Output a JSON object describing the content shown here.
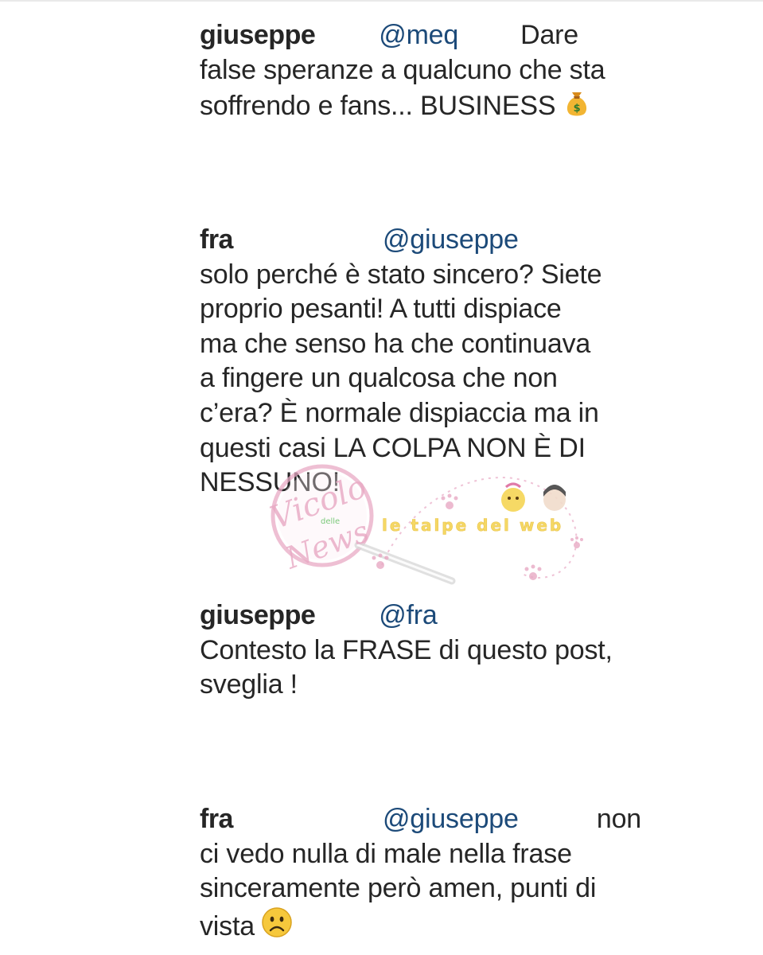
{
  "comments": [
    {
      "username": "giuseppe",
      "mention": "@meq",
      "lead_word": "Dare",
      "lines": [
        "false speranze a qualcuno che sta",
        "soffrendo e fans... BUSINESS"
      ],
      "trailing_emoji": "money-bag-icon"
    },
    {
      "username": "fra",
      "mention": "@giuseppe",
      "lead_word": "",
      "lines": [
        "solo perché è stato sincero? Siete",
        "proprio pesanti! A tutti dispiace",
        "ma che senso ha che continuava",
        "a fingere un qualcosa che non",
        "c’era? È normale dispiaccia ma in",
        "questi casi LA COLPA NON È DI",
        "NESSUNO!"
      ]
    },
    {
      "username": "giuseppe",
      "mention": "@fra",
      "lead_word": "",
      "lines": [
        "Contesto la FRASE di questo post,",
        "sveglia !"
      ]
    },
    {
      "username": "fra",
      "mention": "@giuseppe",
      "lead_word": "non",
      "lines": [
        "ci vedo nulla di male nella frase",
        "sinceramente però amen, punti di",
        "vista"
      ],
      "trailing_emoji": "frowning-face-icon"
    }
  ],
  "watermark": {
    "left_logo_script": "Vicolo",
    "left_logo_small": "delle",
    "left_logo_script2": "News",
    "right_logo_text": "le talpe del web"
  },
  "colors": {
    "text": "#262626",
    "mention": "#1c4a79",
    "watermark_pink": "#e8a9c4",
    "watermark_yellow": "#f4d24a"
  }
}
